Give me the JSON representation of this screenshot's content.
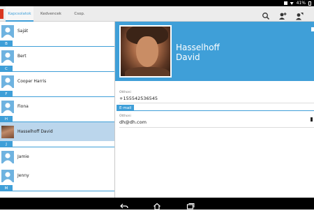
{
  "status_bar": {
    "battery_text": "41%"
  },
  "tabs": [
    {
      "label": "Kapcsolatok",
      "active": true
    },
    {
      "label": "Kedvencek",
      "active": false
    },
    {
      "label": "Csop.",
      "active": false
    }
  ],
  "actions": [
    {
      "icon": "search-icon"
    },
    {
      "icon": "add-contact-icon"
    },
    {
      "icon": "person-settings-icon"
    }
  ],
  "contact_list": {
    "rows": [
      {
        "type": "contact",
        "name": "Saját",
        "avatar": "default"
      },
      {
        "type": "section",
        "letter": "B"
      },
      {
        "type": "contact",
        "name": "Bert",
        "avatar": "default"
      },
      {
        "type": "section",
        "letter": "C"
      },
      {
        "type": "contact",
        "name": "Cooper Harris",
        "avatar": "default"
      },
      {
        "type": "section",
        "letter": "F"
      },
      {
        "type": "contact",
        "name": "Fiona",
        "avatar": "default"
      },
      {
        "type": "section",
        "letter": "H"
      },
      {
        "type": "contact",
        "name": "Hasselhoff David",
        "avatar": "photo",
        "selected": true
      },
      {
        "type": "section",
        "letter": "J"
      },
      {
        "type": "contact",
        "name": "Jamie",
        "avatar": "default"
      },
      {
        "type": "contact",
        "name": "Jenny",
        "avatar": "default"
      },
      {
        "type": "section",
        "letter": "M"
      }
    ]
  },
  "detail": {
    "first_line": "Hasselhoff",
    "second_line": "David",
    "phone_label": "Otthoni",
    "phone_value": "+155542536545",
    "email_section": "E-mail",
    "email_label": "Otthoni",
    "email_value": "dh@dh.com"
  },
  "colors": {
    "accent": "#3f9fd8",
    "selected_row": "#bbd6ec",
    "app_icon": "#d9361f"
  }
}
